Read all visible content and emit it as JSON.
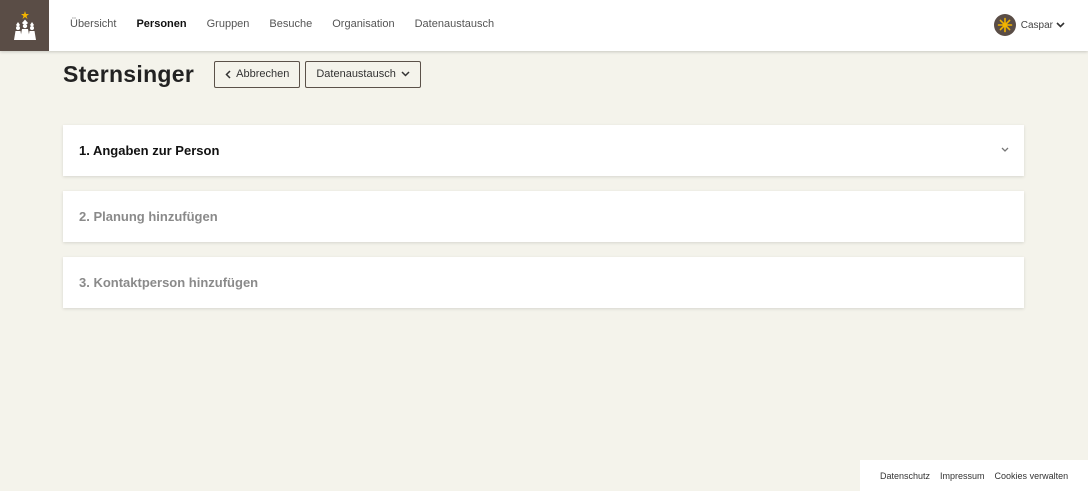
{
  "nav": {
    "items": [
      {
        "label": "Übersicht",
        "active": false
      },
      {
        "label": "Personen",
        "active": true
      },
      {
        "label": "Gruppen",
        "active": false
      },
      {
        "label": "Besuche",
        "active": false
      },
      {
        "label": "Organisation",
        "active": false
      },
      {
        "label": "Datenaustausch",
        "active": false
      }
    ]
  },
  "user": {
    "name": "Caspar"
  },
  "page": {
    "title": "Sternsinger",
    "cancel_label": "Abbrechen",
    "exchange_label": "Datenaustausch"
  },
  "sections": [
    {
      "title": "1. Angaben zur Person",
      "enabled": true
    },
    {
      "title": "2. Planung hinzufügen",
      "enabled": false
    },
    {
      "title": "3. Kontaktperson hinzufügen",
      "enabled": false
    }
  ],
  "footer": {
    "privacy": "Datenschutz",
    "imprint": "Impressum",
    "cookies": "Cookies verwalten"
  },
  "colors": {
    "brand": "#5a4d46",
    "background": "#f4f3eb",
    "star": "#f2b400"
  }
}
